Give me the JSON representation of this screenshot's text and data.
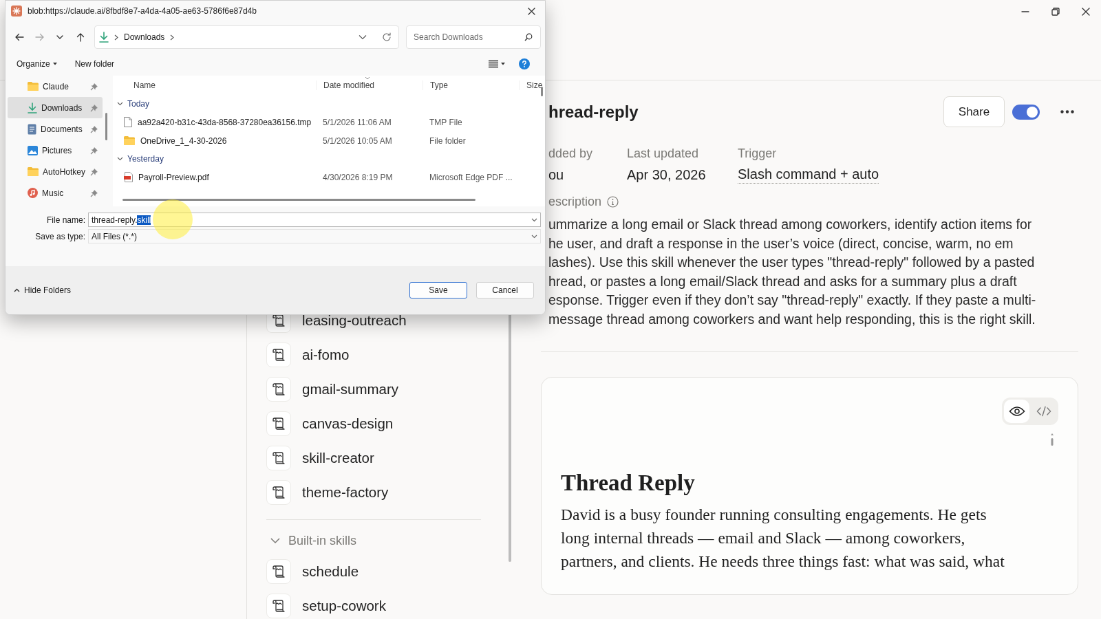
{
  "app": {
    "skills": {
      "items": [
        "leasing-outreach",
        "ai-fomo",
        "gmail-summary",
        "canvas-design",
        "skill-creator",
        "theme-factory"
      ],
      "sections": [
        {
          "label": "Built-in skills",
          "expanded": true,
          "items": [
            "schedule",
            "setup-cowork"
          ]
        }
      ]
    },
    "detail": {
      "title": "hread-reply",
      "share": "Share",
      "enabled": true,
      "meta": [
        {
          "label": "dded by",
          "value": "ou"
        },
        {
          "label": "Last updated",
          "value": "Apr 30, 2026"
        },
        {
          "label": "Trigger",
          "value": "Slash command + auto"
        }
      ],
      "description_label": "escription",
      "description_lines": [
        "ummarize a long email or Slack thread among coworkers, identify action items for",
        "he user, and draft a response in the user’s voice (direct, concise, warm, no em",
        "lashes). Use this skill whenever the user types \"thread-reply\" followed by a pasted",
        "hread, or pastes a long email/Slack thread and asks for a summary plus a draft",
        "esponse. Trigger even if they don’t say \"thread-reply\" exactly. If they paste a multi-",
        "message thread among coworkers and want help responding, this is the right skill."
      ],
      "preview": {
        "views": [
          {
            "kind": "eye",
            "selected": true
          },
          {
            "kind": "code",
            "selected": false
          }
        ],
        "heading": "Thread Reply",
        "body_lines": [
          "David is a busy founder running consulting engagements. He gets",
          "long internal threads — email and Slack — among coworkers,",
          "partners, and clients. He needs three things fast: what was said, what"
        ]
      }
    }
  },
  "dialog": {
    "title": "blob:https://claude.ai/8fbdf8e7-a4da-4a05-ae63-5786f6e87d4b",
    "location": "Downloads",
    "search": {
      "placeholder": "Search Downloads"
    },
    "toolbar": {
      "organize": "Organize",
      "new_folder": "New folder"
    },
    "nav": [
      {
        "label": "Claude",
        "kind": "folder",
        "selected": false
      },
      {
        "label": "Downloads",
        "kind": "download",
        "selected": true
      },
      {
        "label": "Documents",
        "kind": "document",
        "selected": false
      },
      {
        "label": "Pictures",
        "kind": "picture",
        "selected": false
      },
      {
        "label": "AutoHotkey",
        "kind": "folder",
        "selected": false
      },
      {
        "label": "Music",
        "kind": "music",
        "selected": false
      }
    ],
    "columns": [
      "Name",
      "Date modified",
      "Type",
      "Size"
    ],
    "groups": [
      {
        "label": "Today",
        "expanded": true,
        "files": [
          {
            "name": "aa92a420-b31c-43da-8568-37280ea36156.tmp",
            "kind": "file",
            "date": "5/1/2026 11:06 AM",
            "type": "TMP File"
          },
          {
            "name": "OneDrive_1_4-30-2026",
            "kind": "folder",
            "date": "5/1/2026 10:05 AM",
            "type": "File folder"
          }
        ]
      },
      {
        "label": "Yesterday",
        "expanded": true,
        "files": [
          {
            "name": "Payroll-Preview.pdf",
            "kind": "pdf",
            "date": "4/30/2026 8:19 PM",
            "type": "Microsoft Edge PDF ..."
          }
        ]
      }
    ],
    "file_name": {
      "label": "File name:",
      "value": "thread-reply.",
      "selected_value": "skill"
    },
    "save_type": {
      "label": "Save as type:",
      "value": "All Files (*.*)"
    },
    "hide_folders": "Hide Folders",
    "buttons": [
      {
        "label": "Save",
        "default": true
      },
      {
        "label": "Cancel",
        "default": false
      }
    ]
  }
}
